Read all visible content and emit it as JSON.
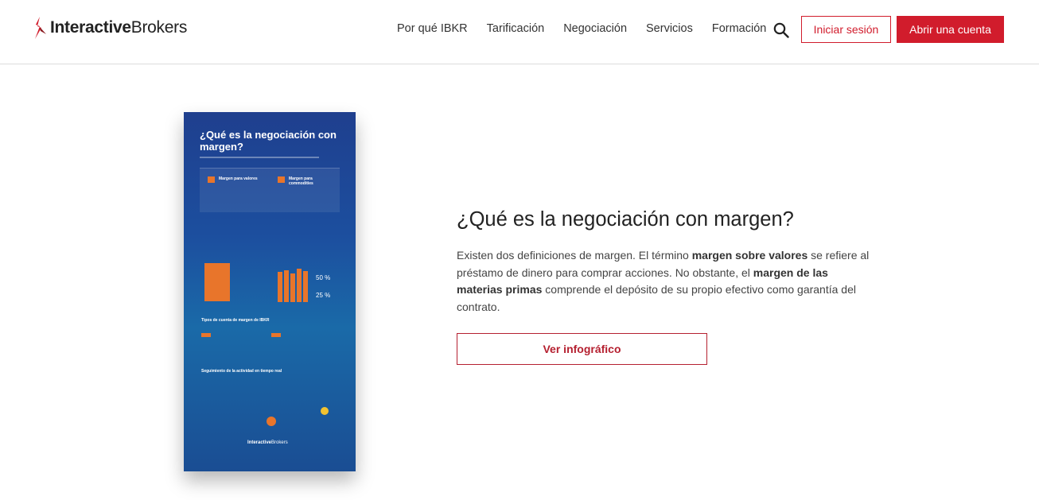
{
  "header": {
    "logo_bold": "Interactive",
    "logo_light": "Brokers",
    "nav": [
      "Por qué IBKR",
      "Tarificación",
      "Negociación",
      "Servicios",
      "Formación"
    ],
    "login_label": "Iniciar sesión",
    "open_account_label": "Abrir una cuenta",
    "icons": {
      "search": "search-icon",
      "logo": "ibkr-logo-icon"
    },
    "brand_color": "#d11c2c"
  },
  "infographic": {
    "title": "¿Qué es la negociación con margen?",
    "card_left": "Margen para valores",
    "card_right": "Margen para commodities",
    "section_types": "Tipos de cuenta de margen de IBKR",
    "section_tracking": "Seguimiento de la actividad en tiempo real",
    "percent_1": "50 %",
    "percent_2": "25 %",
    "logo_bold": "Interactive",
    "logo_light": "Brokers"
  },
  "main": {
    "title": "¿Qué es la negociación con margen?",
    "desc_1": "Existen dos definiciones de margen. El término ",
    "desc_b1": "margen sobre valores",
    "desc_2": " se refiere al préstamo de dinero para comprar acciones. No obstante, el ",
    "desc_b2": "margen de las materias primas",
    "desc_3": " comprende el depósito de su propio efectivo como garantía del contrato.",
    "button_label": "Ver infográfico"
  }
}
